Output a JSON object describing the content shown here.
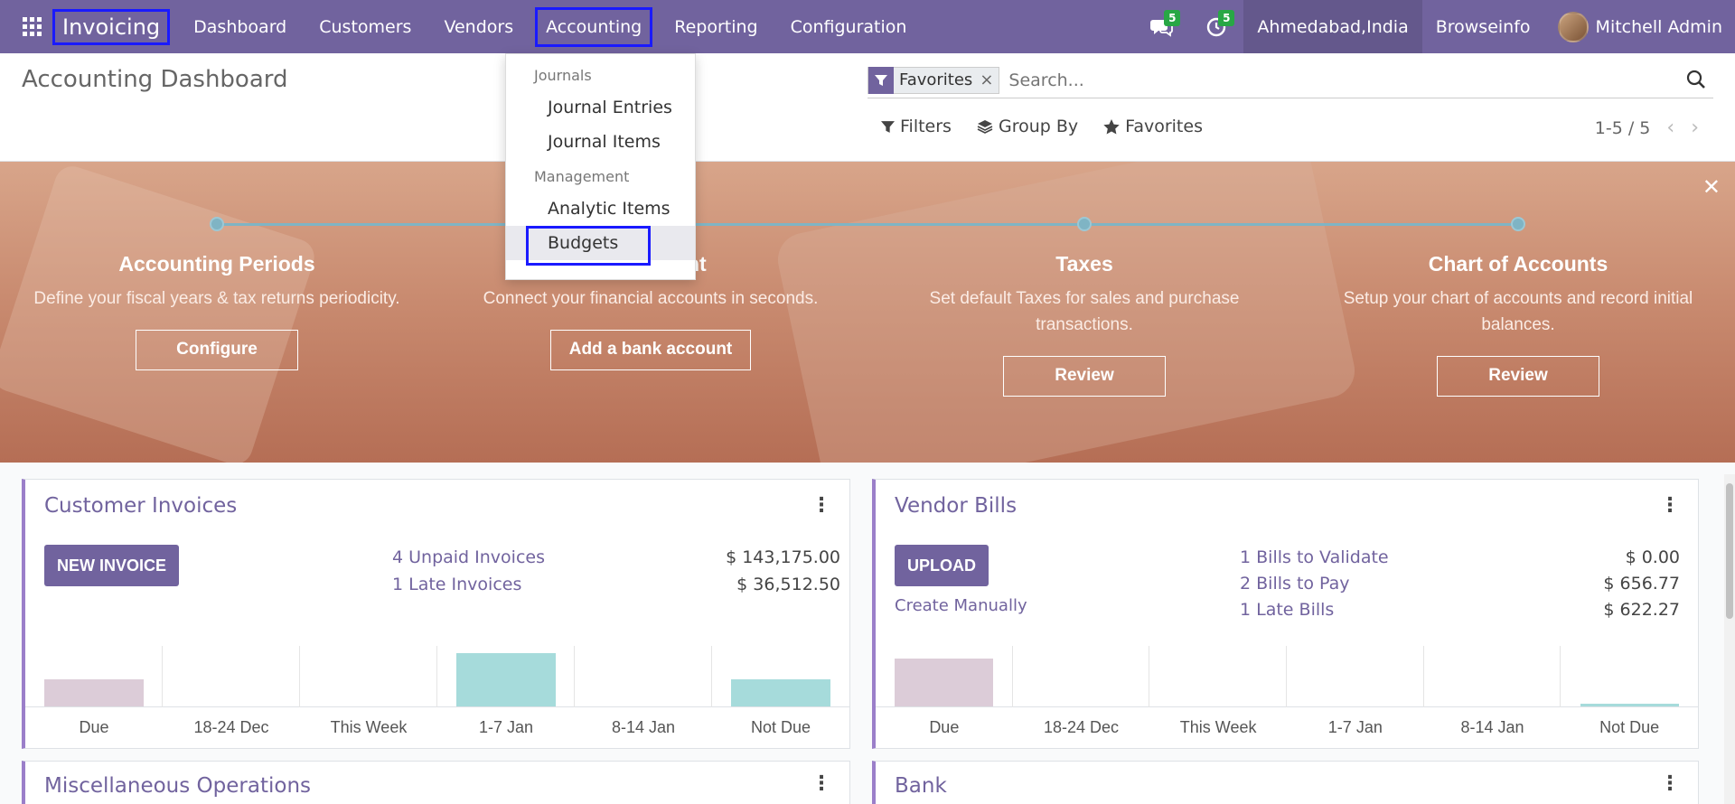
{
  "navbar": {
    "apps_icon": "grid-icon",
    "brand": "Invoicing",
    "menu": [
      "Dashboard",
      "Customers",
      "Vendors",
      "Accounting",
      "Reporting",
      "Configuration"
    ],
    "messages_count": "5",
    "activities_count": "5",
    "company": "Ahmedabad,India",
    "website": "Browseinfo",
    "user": "Mitchell Admin"
  },
  "control": {
    "title": "Accounting Dashboard",
    "facet": "Favorites",
    "search_placeholder": "Search...",
    "filters": "Filters",
    "group_by": "Group By",
    "favorites": "Favorites",
    "pager": "1-5 / 5"
  },
  "dropdown": {
    "section1": "Journals",
    "items1": [
      "Journal Entries",
      "Journal Items"
    ],
    "section2": "Management",
    "items2": [
      "Analytic Items",
      "Budgets"
    ]
  },
  "banner": {
    "steps": [
      {
        "title": "Accounting Periods",
        "desc": "Define your fiscal years & tax returns periodicity.",
        "button": "Configure"
      },
      {
        "title": "nt",
        "desc": "Connect your financial accounts in seconds.",
        "button": "Add a bank account"
      },
      {
        "title": "Taxes",
        "desc": "Set default Taxes for sales and purchase transactions.",
        "button": "Review"
      },
      {
        "title": "Chart of Accounts",
        "desc": "Setup your chart of accounts and record initial balances.",
        "button": "Review"
      }
    ]
  },
  "cards": {
    "customer_invoices": {
      "title": "Customer Invoices",
      "button": "NEW INVOICE",
      "stats": [
        {
          "label": "4 Unpaid Invoices",
          "value": "$ 143,175.00"
        },
        {
          "label": "1 Late Invoices",
          "value": "$ 36,512.50"
        }
      ],
      "graph_labels": [
        "Due",
        "18-24 Dec",
        "This Week",
        "1-7 Jan",
        "8-14 Jan",
        "Not Due"
      ],
      "graph_values": [
        0.45,
        0,
        0,
        0.9,
        0,
        0.45
      ]
    },
    "vendor_bills": {
      "title": "Vendor Bills",
      "button": "UPLOAD",
      "link": "Create Manually",
      "stats": [
        {
          "label": "1 Bills to Validate",
          "value": "$ 0.00"
        },
        {
          "label": "2 Bills to Pay",
          "value": "$ 656.77"
        },
        {
          "label": "1 Late Bills",
          "value": "$ 622.27"
        }
      ],
      "graph_labels": [
        "Due",
        "18-24 Dec",
        "This Week",
        "1-7 Jan",
        "8-14 Jan",
        "Not Due"
      ],
      "graph_values": [
        0.8,
        0,
        0,
        0,
        0,
        0.05
      ]
    },
    "misc": {
      "title": "Miscellaneous Operations"
    },
    "bank": {
      "title": "Bank"
    }
  },
  "colors": {
    "brand": "#71639e",
    "past_bar": "#dcccd8",
    "future_bar": "#a6dbdb"
  }
}
